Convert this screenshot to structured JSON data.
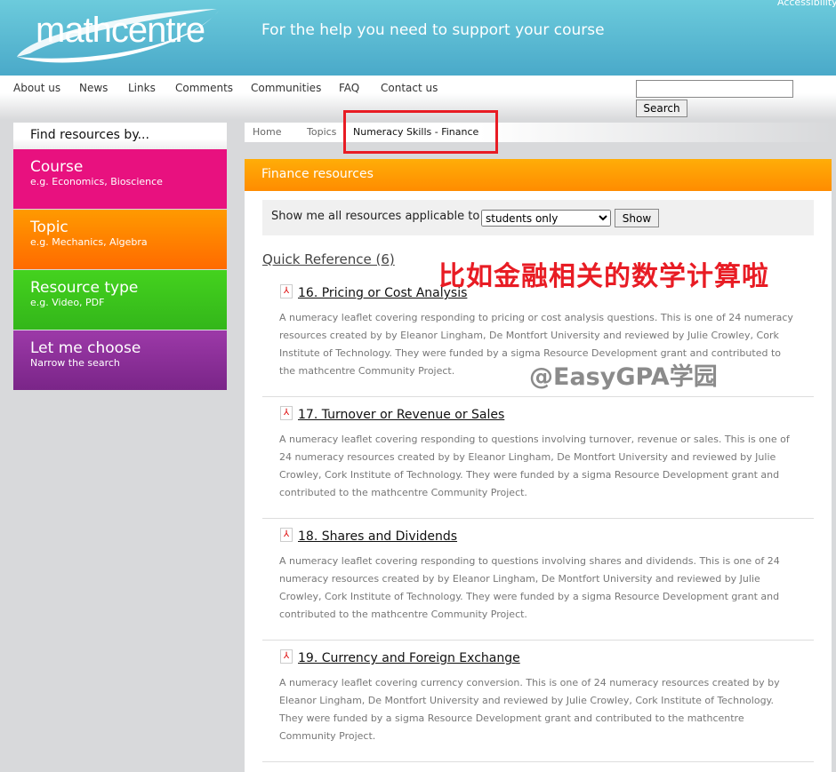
{
  "header": {
    "logo": "mathcentre",
    "tagline": "For the help you need to support your course",
    "accessibility": "Accessibility"
  },
  "nav": {
    "items": [
      "About us",
      "News",
      "Links",
      "Comments",
      "Communities",
      "FAQ",
      "Contact us"
    ],
    "search_button": "Search",
    "search_value": ""
  },
  "sidebar": {
    "heading": "Find resources by...",
    "items": [
      {
        "title": "Course",
        "sub": "e.g. Economics, Bioscience",
        "color": "#e8117f"
      },
      {
        "title": "Topic",
        "sub": "e.g. Mechanics, Algebra",
        "color": "#ff7a00"
      },
      {
        "title": "Resource type",
        "sub": "e.g. Video, PDF",
        "color": "#3fc41e"
      },
      {
        "title": "Let me choose",
        "sub": "Narrow the search",
        "color": "#8a2b96"
      }
    ]
  },
  "breadcrumb": [
    "Home",
    "Topics",
    "Numeracy Skills - Finance"
  ],
  "main": {
    "heading": "Finance resources",
    "filter_label": "Show me all resources applicable to",
    "filter_value": "students only",
    "show_button": "Show",
    "section": "Quick Reference (6)",
    "items": [
      {
        "title": "16. Pricing or Cost Analysis",
        "desc": "A numeracy leaflet covering responding to pricing or cost analysis questions. This is one of 24 numeracy resources created by by Eleanor Lingham, De Montfort University and reviewed by Julie Crowley, Cork Institute of Technology. They were funded by a sigma Resource Development grant and contributed to the mathcentre Community Project."
      },
      {
        "title": "17. Turnover or Revenue or Sales",
        "desc": "A numeracy leaflet covering responding to questions involving turnover, revenue or sales. This is one of 24 numeracy resources created by by Eleanor Lingham, De Montfort University and reviewed by Julie Crowley, Cork Institute of Technology. They were funded by a sigma Resource Development grant and contributed to the mathcentre Community Project."
      },
      {
        "title": "18. Shares and Dividends",
        "desc": "A numeracy leaflet covering responding to questions involving shares and dividends. This is one of 24 numeracy resources created by by Eleanor Lingham, De Montfort University and reviewed by Julie Crowley, Cork Institute of Technology. They were funded by a sigma Resource Development grant and contributed to the mathcentre Community Project."
      },
      {
        "title": "19. Currency and Foreign Exchange",
        "desc": "A numeracy leaflet covering currency conversion. This is one of 24 numeracy resources created by by Eleanor Lingham, De Montfort University and reviewed by Julie Crowley, Cork Institute of Technology. They were funded by a sigma Resource Development grant and contributed to the mathcentre Community Project."
      }
    ]
  },
  "annotation": "比如金融相关的数学计算啦",
  "watermark": "@EasyGPA学园"
}
